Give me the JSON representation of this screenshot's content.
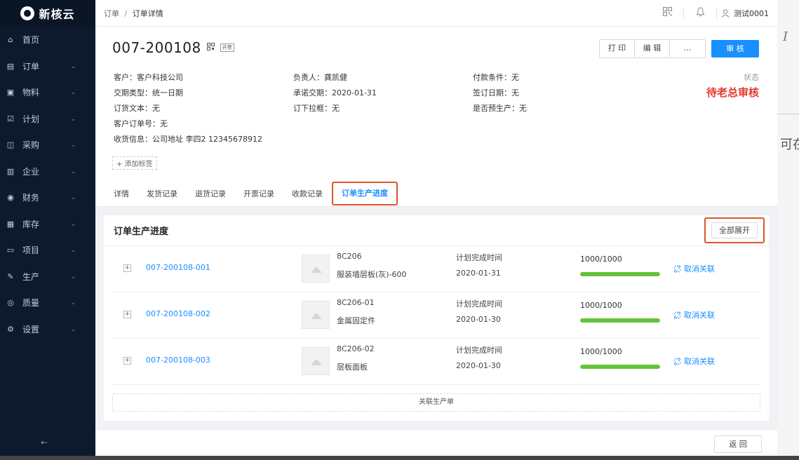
{
  "app": {
    "logo_text": "新核云"
  },
  "sidebar": {
    "items": [
      {
        "label": "首页",
        "icon": "home-icon",
        "glyph": "⌂",
        "has_children": false
      },
      {
        "label": "订单",
        "icon": "order-icon",
        "glyph": "▤",
        "has_children": true
      },
      {
        "label": "物料",
        "icon": "material-icon",
        "glyph": "▣",
        "has_children": true
      },
      {
        "label": "计划",
        "icon": "plan-icon",
        "glyph": "☑",
        "has_children": true
      },
      {
        "label": "采购",
        "icon": "purchase-icon",
        "glyph": "◫",
        "has_children": true
      },
      {
        "label": "企业",
        "icon": "enterprise-icon",
        "glyph": "▥",
        "has_children": true
      },
      {
        "label": "财务",
        "icon": "finance-icon",
        "glyph": "◉",
        "has_children": true
      },
      {
        "label": "库存",
        "icon": "inventory-icon",
        "glyph": "▦",
        "has_children": true
      },
      {
        "label": "项目",
        "icon": "project-icon",
        "glyph": "▭",
        "has_children": true
      },
      {
        "label": "生产",
        "icon": "production-icon",
        "glyph": "✎",
        "has_children": true
      },
      {
        "label": "质量",
        "icon": "quality-icon",
        "glyph": "◎",
        "has_children": true
      },
      {
        "label": "设置",
        "icon": "settings-icon",
        "glyph": "⚙",
        "has_children": true
      }
    ],
    "collapse_glyph": "←"
  },
  "topbar": {
    "breadcrumb_root": "订单",
    "breadcrumb_sep": "/",
    "breadcrumb_current": "订单详情",
    "user_name": "测试0001"
  },
  "order": {
    "number": "007-200108",
    "invoice_tag": "开票",
    "buttons": {
      "print": "打 印",
      "edit": "编 辑",
      "more": "...",
      "approve": "审 核"
    },
    "info": [
      [
        "客户：客户科技公司",
        "负责人：龚凯健",
        "付款条件：无"
      ],
      [
        "交期类型：统一日期",
        "承诺交期：2020-01-31",
        "签订日期：无"
      ],
      [
        "订货文本：无",
        "订下拉框：无",
        "是否预生产：无"
      ],
      [
        "客户订单号：无",
        "",
        ""
      ],
      [
        "收货信息：公司地址 李四2 12345678912",
        "",
        ""
      ]
    ],
    "status_label": "状态",
    "status_value": "待老总审核",
    "add_tag": "+ 添加标签"
  },
  "tabs": [
    {
      "label": "详情",
      "active": false
    },
    {
      "label": "发货记录",
      "active": false
    },
    {
      "label": "退货记录",
      "active": false
    },
    {
      "label": "开票记录",
      "active": false
    },
    {
      "label": "收款记录",
      "active": false
    },
    {
      "label": "订单生产进度",
      "active": true
    }
  ],
  "progress": {
    "title": "订单生产进度",
    "expand_all": "全部展开",
    "plan_label": "计划完成时间",
    "unlink_label": "取消关联",
    "rows": [
      {
        "code": "007-200108-001",
        "sku": "8C206",
        "name": "服装墙层板(灰)-600",
        "date": "2020-01-31",
        "qty": "1000/1000",
        "progress": 1.0
      },
      {
        "code": "007-200108-002",
        "sku": "8C206-01",
        "name": "金属固定件",
        "date": "2020-01-30",
        "qty": "1000/1000",
        "progress": 1.0
      },
      {
        "code": "007-200108-003",
        "sku": "8C206-02",
        "name": "层板面板",
        "date": "2020-01-30",
        "qty": "1000/1000",
        "progress": 1.0
      }
    ],
    "link_production": "关联生产单"
  },
  "footer": {
    "back": "返 回"
  },
  "background": {
    "fragment_text": "可在"
  },
  "colors": {
    "accent": "#1890ff",
    "status": "#e6352f",
    "progress": "#67c23a",
    "highlight": "#e0532e",
    "sidebar": "#0d1a2e"
  }
}
